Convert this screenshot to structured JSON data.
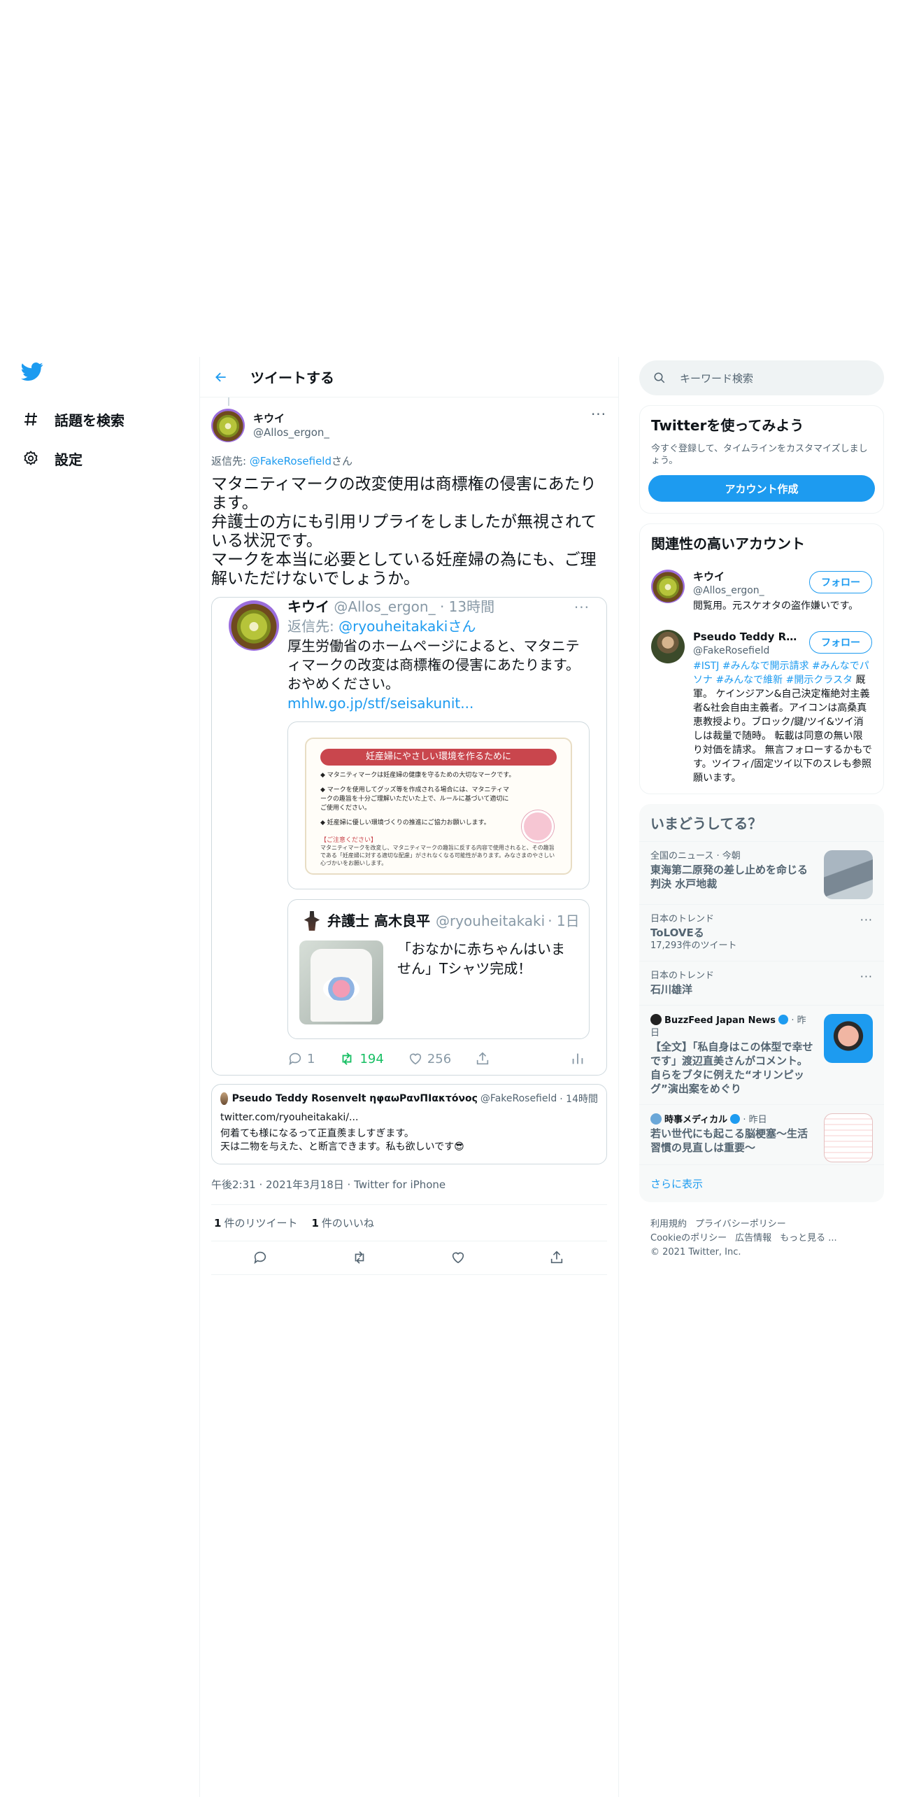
{
  "nav": {
    "logo": "twitter-logo",
    "items": [
      {
        "label": "話題を検索",
        "icon": "hashtag-icon"
      },
      {
        "label": "設定",
        "icon": "gear-icon"
      }
    ]
  },
  "header": {
    "title": "ツイートする"
  },
  "tweet": {
    "name": "キウイ",
    "handle": "@Allos_ergon_",
    "reply_prefix": "返信先: ",
    "reply_to": "@FakeRosefield",
    "reply_suffix": "さん",
    "text": "マタニティマークの改変使用は商標権の侵害にあたります。\n弁護士の方にも引用リプライをしましたが無視されている状況です。\nマークを本当に必要としている妊産婦の為にも、ご理解いただけないでしょうか。",
    "timestamp": "午後2:31 · 2021年3月18日 · Twitter for iPhone",
    "retweets_count": "1",
    "retweets_label": "件のリツイート",
    "likes_count": "1",
    "likes_label": "件のいいね"
  },
  "quoted": {
    "name": "キウイ",
    "handle": "@Allos_ergon_",
    "time": "· 13時間",
    "reply_prefix": "返信先: ",
    "reply_to": "@ryouheitakakiさん",
    "text": "厚生労働省のホームページによると、マタニティマークの改変は商標権の侵害にあたります。\nおやめください。",
    "link": "mhlw.go.jp/stf/seisakunit...",
    "poster": {
      "title": "妊産婦にやさしい環境を作るために",
      "line1": "◆ マタニティマークは妊産婦の健康を守るための大切なマークです。",
      "line2": "◆ マークを使用してグッズ等を作成される場合には、マタニティマークの趣旨を十分ご理解いただいた上で、ルールに基づいて適切にご使用ください。",
      "line3": "◆ 妊産婦に優しい環境づくりの推進にご協力お願いします。",
      "note_title": "【ご注意ください】",
      "note": "マタニティマークを改変し、マタニティマークの趣旨に反する内容で使用されると、その趣旨である「妊産婦に対する適切な配慮」がされなくなる可能性があります。みなさまのやさしい心づかいをお願いします。"
    },
    "nested": {
      "name": "弁護士 高木良平",
      "handle": "@ryouheitakaki",
      "time": "· 1日",
      "text": "「おなかに赤ちゃんはいません」Tシャツ完成！"
    },
    "replies": "1",
    "retweets": "194",
    "likes": "256"
  },
  "quote_tweet": {
    "name": "Pseudo Teddy Rosenvelt ηφαωΡανΠΙακτόνος",
    "handle": "@FakeRosefield",
    "time": "· 14時間",
    "link": "twitter.com/ryouheitakaki/...",
    "text": "何着ても様になるって正直羨ましすぎます。\n天は二物を与えた、と断言できます。私も欲しいです😎"
  },
  "search": {
    "placeholder": "キーワード検索"
  },
  "signup": {
    "title": "Twitterを使ってみよう",
    "desc": "今すぐ登録して、タイムラインをカスタマイズしましょう。",
    "button": "アカウント作成"
  },
  "related": {
    "title": "関連性の高いアカウント",
    "follow_label": "フォロー",
    "accounts": [
      {
        "name": "キウイ",
        "handle": "@Allos_ergon_",
        "bio_plain": "閲覧用。元スケオタの盗作嫌いです。"
      },
      {
        "name": "Pseudo Teddy Rose...",
        "handle": "@FakeRosefield",
        "bio_tags": "#ISTJ #みんなで開示請求 #みんなでパソナ #みんなで維新 #開示クラスタ",
        "bio_plain": " 厩軍。 ケインジアン&自己決定権絶対主義者&社会自由主義者。アイコンは高桑真恵教授より。ブロック/鍵/ツイ&ツイ消しは裁量で随時。 転載は同意の無い限り対価を請求。 無言フォローするかもです。ツイフィ/固定ツイ以下のスレも参照願います。"
      }
    ]
  },
  "trends": {
    "title": "いまどうしてる？",
    "items": [
      {
        "context": "全国のニュース · 今朝",
        "title": "東海第二原発の差し止めを命じる判決 水戸地裁",
        "thumb": "coast-photo"
      },
      {
        "context": "日本のトレンド",
        "title": "ToLOVEる",
        "count": "17,293件のツイート"
      },
      {
        "context": "日本のトレンド",
        "title": "石川雄洋"
      },
      {
        "source": "BuzzFeed Japan News",
        "time": "· 昨日",
        "title": "【全文】「私自身はこの体型で幸せです」渡辺直美さんがコメント。自らをブタに例えた“オリンピッグ”演出案をめぐり",
        "thumb": "person-photo"
      },
      {
        "source": "時事メディカル",
        "time": "· 昨日",
        "title": "若い世代にも起こる脳梗塞～生活習慣の見直しは重要～",
        "thumb": "medical-article"
      }
    ],
    "show_more": "さらに表示"
  },
  "footer": {
    "links1": [
      "利用規約",
      "プライバシーポリシー"
    ],
    "links2": [
      "Cookieのポリシー",
      "広告情報",
      "もっと見る ..."
    ],
    "copyright": "© 2021 Twitter, Inc."
  },
  "colors": {
    "accent": "#1d9bf0",
    "retweet": "#17bf63",
    "text": "#0f1419",
    "muted": "#536471"
  }
}
